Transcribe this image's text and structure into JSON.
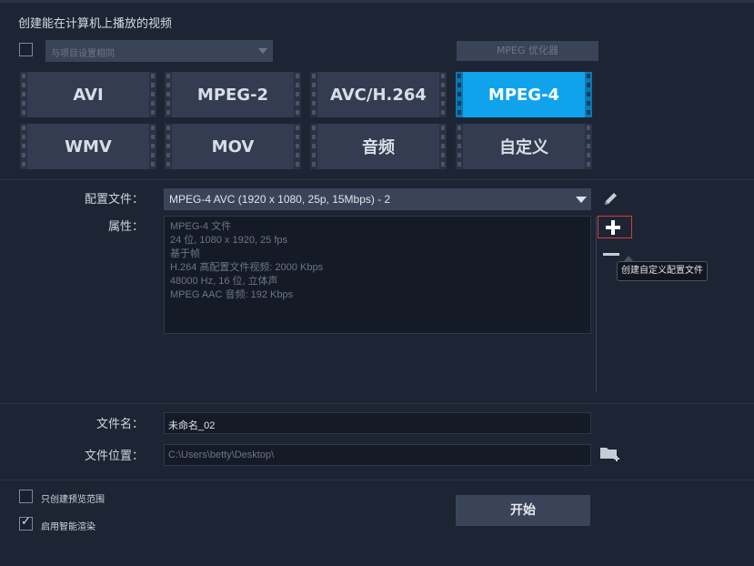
{
  "header": {
    "title": "创建能在计算机上播放的视频"
  },
  "preset": {
    "placeholder": "与项目设置相同"
  },
  "optimizer": {
    "label": "MPEG 优化器"
  },
  "formats": [
    {
      "label": "AVI",
      "active": false
    },
    {
      "label": "MPEG-2",
      "active": false
    },
    {
      "label": "AVC/H.264",
      "active": false
    },
    {
      "label": "MPEG-4",
      "active": true
    },
    {
      "label": "WMV",
      "active": false
    },
    {
      "label": "MOV",
      "active": false
    },
    {
      "label": "音频",
      "active": false
    },
    {
      "label": "自定义",
      "active": false
    }
  ],
  "profile": {
    "label": "配置文件：",
    "value": "MPEG-4 AVC (1920 x 1080, 25p, 15Mbps) - 2"
  },
  "properties": {
    "label": "属性：",
    "lines": [
      "MPEG-4 文件",
      "24 位, 1080 x 1920, 25 fps",
      "基于帧",
      "H.264 高配置文件视频: 2000 Kbps",
      "48000 Hz, 16 位, 立体声",
      "MPEG AAC 音频: 192 Kbps"
    ]
  },
  "tooltip": {
    "text": "创建自定义配置文件"
  },
  "filename": {
    "label": "文件名：",
    "value": "未命名_02"
  },
  "location": {
    "label": "文件位置：",
    "value": "C:\\Users\\betty\\Desktop\\"
  },
  "options": {
    "preview_only": {
      "label": "只创建预览范围",
      "checked": false
    },
    "smart_render": {
      "label": "启用智能渲染",
      "checked": true
    }
  },
  "start": {
    "label": "开始"
  },
  "colors": {
    "accent": "#10a3ec",
    "background": "#1d2433",
    "highlight_border": "#d63d3d"
  }
}
